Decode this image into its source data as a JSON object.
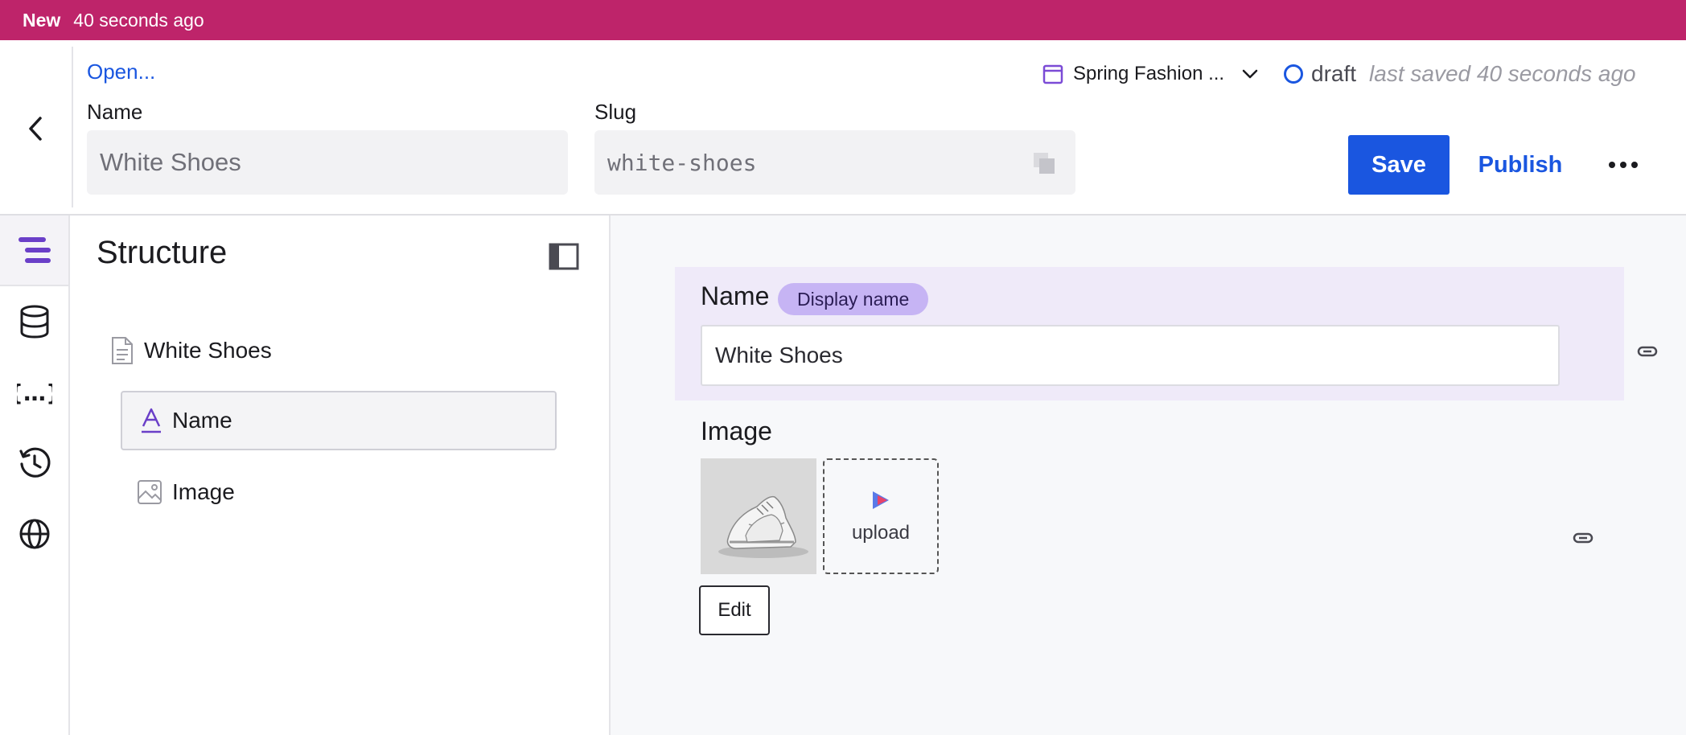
{
  "topbar": {
    "new_label": "New",
    "time_label": "40 seconds ago",
    "color": "#be246a"
  },
  "header": {
    "open_link": "Open...",
    "name_label": "Name",
    "name_value": "White Shoes",
    "slug_label": "Slug",
    "slug_value": "white-shoes",
    "release_label": "Spring Fashion ...",
    "status_label": "draft",
    "last_saved": "last saved 40 seconds ago",
    "save_label": "Save",
    "publish_label": "Publish",
    "accent_color": "#1a56e0"
  },
  "rail": {
    "items": [
      {
        "icon": "structure-icon",
        "active": true
      },
      {
        "icon": "database-icon",
        "active": false
      },
      {
        "icon": "code-braces-icon",
        "active": false
      },
      {
        "icon": "history-icon",
        "active": false
      },
      {
        "icon": "globe-icon",
        "active": false
      }
    ]
  },
  "structure": {
    "title": "Structure",
    "root_label": "White Shoes",
    "items": [
      {
        "label": "Name",
        "icon": "text-field-icon",
        "selected": true
      },
      {
        "label": "Image",
        "icon": "image-field-icon",
        "selected": false
      }
    ]
  },
  "editor": {
    "name_field": {
      "label": "Name",
      "badge": "Display name",
      "value": "White Shoes"
    },
    "image_field": {
      "label": "Image",
      "upload_label": "upload",
      "edit_label": "Edit"
    }
  }
}
